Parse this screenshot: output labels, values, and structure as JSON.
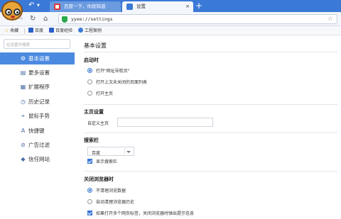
{
  "tabs": [
    {
      "title": "百度一下，你就知道",
      "active": false
    },
    {
      "title": "设置",
      "active": true
    }
  ],
  "address": {
    "url": "yyee://settings"
  },
  "bookmarks": [
    {
      "label": "收藏",
      "icon": "star-icon"
    },
    {
      "label": "百度",
      "icon": "baidu-icon"
    },
    {
      "label": "百度经验",
      "icon": "baidu-icon"
    },
    {
      "label": "工程案例",
      "icon": "gear-icon"
    }
  ],
  "sidebar": {
    "search_placeholder": "在设置中搜索",
    "items": [
      {
        "label": "基本设置",
        "icon": "gear-icon",
        "glyph": "⚙",
        "active": true
      },
      {
        "label": "更多设置",
        "icon": "document-icon",
        "glyph": "▤",
        "active": false
      },
      {
        "label": "扩展程序",
        "icon": "grid-icon",
        "glyph": "▦",
        "active": false
      },
      {
        "label": "历史记录",
        "icon": "clock-icon",
        "glyph": "◷",
        "active": false
      },
      {
        "label": "鼠标手势",
        "icon": "mouse-icon",
        "glyph": "⌖",
        "active": false
      },
      {
        "label": "快捷键",
        "icon": "keyboard-icon",
        "glyph": "A",
        "active": false
      },
      {
        "label": "广告过滤",
        "icon": "block-icon",
        "glyph": "⊘",
        "active": false
      },
      {
        "label": "信任网站",
        "icon": "shield-icon",
        "glyph": "◆",
        "active": false
      }
    ]
  },
  "main": {
    "title": "基本设置",
    "startup": {
      "heading": "启动时",
      "options": [
        "打开\"网址导航页\"",
        "打开上次未关闭的页面列表",
        "打开主页"
      ],
      "selected": 0
    },
    "homepage": {
      "heading": "主页设置",
      "label": "自定义主页",
      "value": ""
    },
    "searchbar": {
      "heading": "搜索栏",
      "engine": "百度",
      "show_label": "显示搜索栏",
      "show_checked": true
    },
    "close": {
      "heading": "关闭浏览器时",
      "options": [
        "不清理浏览数据",
        "自动清理浏览器历史"
      ],
      "selected": 0,
      "warn_label": "如果打开多个网页标签，关闭浏览器时弹出提示信息",
      "warn_checked": true
    }
  },
  "colors": {
    "accent": "#3b79d6",
    "sidebar_active": "#4c8ae0"
  }
}
